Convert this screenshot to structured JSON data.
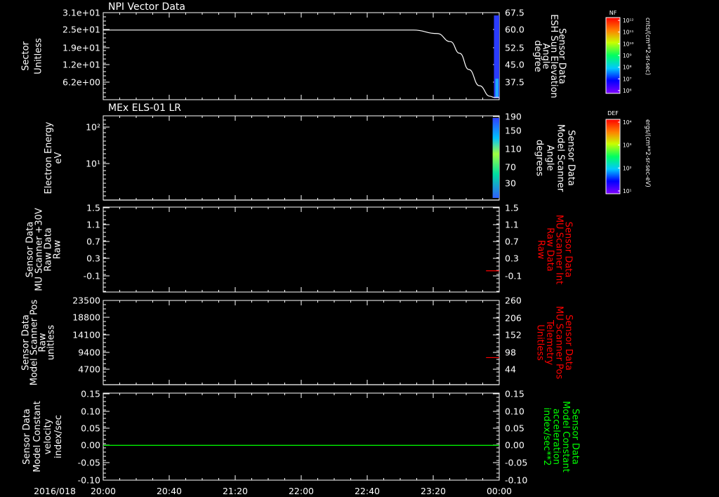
{
  "chart_data": [
    {
      "type": "line",
      "title": "NPI Vector Data",
      "ylabel": [
        "Sector",
        "Unitless"
      ],
      "ylabel_right": [
        "Sensor Data",
        "ESH Sun Elevation",
        "Angle",
        "degree"
      ],
      "yticks": [
        "3.1e+01",
        "2.5e+01",
        "1.9e+01",
        "1.2e+01",
        "6.2e+00"
      ],
      "yticks_right": [
        "67.5",
        "60.0",
        "52.5",
        "45.0",
        "37.5"
      ],
      "ylim_right": [
        30,
        67.5
      ],
      "series": [
        {
          "color": "#ffffff",
          "x": [
            0,
            235,
            253,
            263,
            270,
            277,
            285,
            293,
            296,
            300
          ],
          "y": [
            60,
            60,
            58.5,
            55,
            50,
            43,
            36,
            31.5,
            31,
            31
          ]
        }
      ],
      "spectrogram_strip": {
        "x_start": 296,
        "x_end": 300,
        "colors": [
          "#3030ff",
          "#6080ff",
          "#00a0ff"
        ]
      },
      "colorbar": {
        "name": "NF",
        "ticks": [
          "10¹²",
          "10¹¹",
          "10¹⁰",
          "10⁹",
          "10⁸",
          "10⁷",
          "10⁶"
        ],
        "unit": "cnts/(cm**2-sr-sec)"
      }
    },
    {
      "type": "line",
      "title": "MEx ELS-01 LR",
      "ylabel": [
        "Electron Energy",
        "eV"
      ],
      "ylabel_right": [
        "Sensor Data",
        "Model Scanner",
        "Angle",
        "degrees"
      ],
      "yticks": [
        "10²",
        "10¹"
      ],
      "yticks_right": [
        "190",
        "150",
        "110",
        "70",
        "30"
      ],
      "ylim_right": [
        10,
        190
      ],
      "series": [
        {
          "color": "#ffffff",
          "x": [
            0,
            296,
            300
          ],
          "y": [
            10,
            10,
            10
          ]
        }
      ],
      "spectrogram_strip": {
        "x_start": 295,
        "x_end": 300
      },
      "colorbar": {
        "name": "DEF",
        "ticks": [
          "10⁴",
          "10³",
          "10²",
          "10¹"
        ],
        "unit": "ergs/(cm**2-sr-sec-eV)"
      }
    },
    {
      "type": "line",
      "ylabel": [
        "Sensor Data",
        "MU Scanner +30V",
        "Raw Data",
        "Raw"
      ],
      "ylabel_right": [
        "Sensor Data",
        "MU Scanner Int",
        "Raw Data",
        "Raw"
      ],
      "yticks": [
        "1.5",
        "1.1",
        "0.7",
        "0.3",
        "-0.1"
      ],
      "yticks_right": [
        "1.5",
        "1.1",
        "0.7",
        "0.3",
        "-0.1"
      ],
      "ylim": [
        -0.5,
        1.5
      ],
      "series": [
        {
          "color": "#ff0000",
          "x": [
            290,
            300
          ],
          "y": [
            0.0,
            0.0
          ]
        }
      ]
    },
    {
      "type": "line",
      "ylabel": [
        "Sensor Data",
        "Model Scanner Pos",
        "Raw",
        "unitless"
      ],
      "ylabel_right": [
        "Sensor Data",
        "MU Scanner Pos",
        "Telemetry",
        "Unitless"
      ],
      "yticks": [
        "23500",
        "18800",
        "14100",
        "9400",
        "4700"
      ],
      "yticks_right": [
        "260",
        "206",
        "152",
        "98",
        "44"
      ],
      "ylim": [
        0,
        23500
      ],
      "ylim_right": [
        0,
        260
      ],
      "series": [
        {
          "color": "#ffffff",
          "x": [
            0,
            300
          ],
          "y": [
            0,
            0
          ]
        },
        {
          "color": "#ff0000",
          "x": [
            290,
            300
          ],
          "y": [
            7550,
            7550
          ]
        }
      ]
    },
    {
      "type": "line",
      "ylabel": [
        "Sensor Data",
        "Model Constant",
        "velocity",
        "index/sec"
      ],
      "ylabel_right": [
        "Sensor Data",
        "Model Constant",
        "acceleration",
        "index/sec**2"
      ],
      "yticks": [
        "0.15",
        "0.10",
        "0.05",
        "0.00",
        "-0.05",
        "-0.10"
      ],
      "yticks_right": [
        "0.15",
        "0.10",
        "0.05",
        "0.00",
        "-0.05",
        "-0.10"
      ],
      "ylim": [
        -0.1,
        0.15
      ],
      "series": [
        {
          "color": "#00ff00",
          "x": [
            0,
            300
          ],
          "y": [
            0,
            0
          ]
        }
      ]
    }
  ],
  "x_axis": {
    "date": "2016/018",
    "ticks": [
      "20:00",
      "20:40",
      "21:20",
      "22:00",
      "22:40",
      "23:20",
      "00:00"
    ],
    "xlim_minutes": [
      0,
      240
    ]
  },
  "colors": {
    "background": "#000000",
    "axes": "#ffffff",
    "right_label_red": "#ff0000",
    "right_label_green": "#00ff00"
  }
}
